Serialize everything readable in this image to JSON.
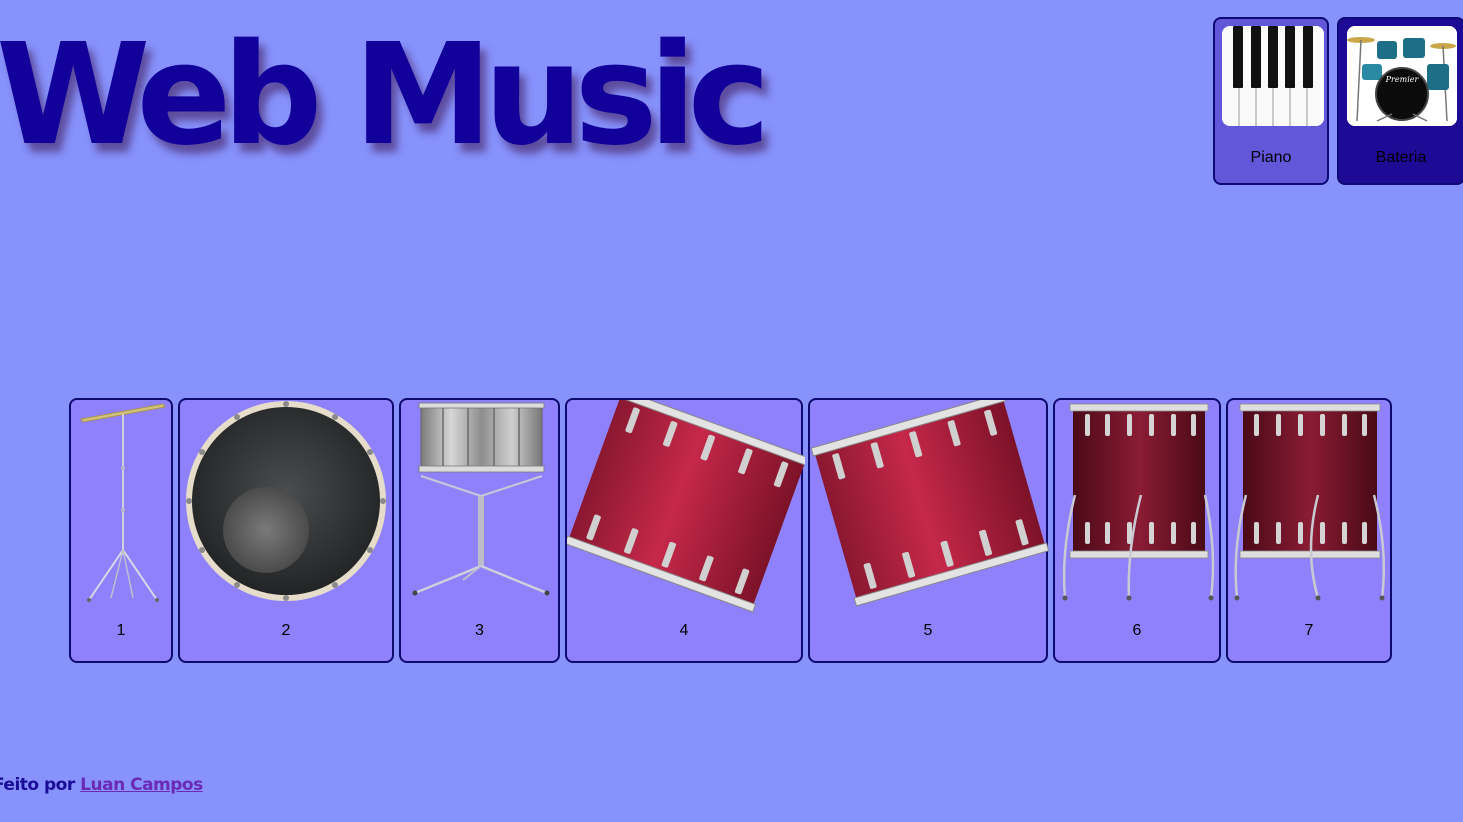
{
  "header": {
    "title": "Web Music"
  },
  "nav": [
    {
      "label": "Piano",
      "icon": "piano-keys-image"
    },
    {
      "label": "Bateria",
      "icon": "drum-kit-image"
    }
  ],
  "pads": [
    {
      "number": "1",
      "icon": "cymbal-image"
    },
    {
      "number": "2",
      "icon": "bass-drum-image"
    },
    {
      "number": "3",
      "icon": "snare-drum-image"
    },
    {
      "number": "4",
      "icon": "tom-drum-image"
    },
    {
      "number": "5",
      "icon": "tom-drum-image"
    },
    {
      "number": "6",
      "icon": "floor-tom-image"
    },
    {
      "number": "7",
      "icon": "floor-tom-image"
    }
  ],
  "footer": {
    "prefix": "Feito por",
    "author": "Luan Campos"
  },
  "colors": {
    "background": "#8792fd",
    "title": "#12009a",
    "pad": "#8f81fb",
    "pad_border": "#0f0a6e",
    "nav_piano": "#6157d8",
    "nav_bateria_active": "#1f0a95",
    "drum_red": "#b01e3a"
  }
}
